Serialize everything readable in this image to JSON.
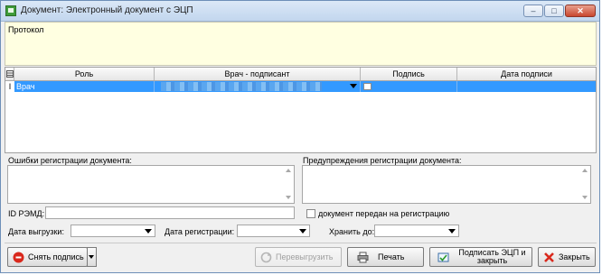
{
  "window": {
    "title": "Документ: Электронный документ с ЭЦП",
    "minimize_glyph": "–",
    "maximize_glyph": "□",
    "close_glyph": "✕"
  },
  "protocol": {
    "label": "Протокол"
  },
  "grid": {
    "columns": [
      "Роль",
      "Врач - подписант",
      "Подпись",
      "Дата подписи"
    ],
    "row_marker": "I",
    "row": {
      "role": "Врач",
      "doctor": "",
      "signature": "",
      "date": ""
    }
  },
  "errors": {
    "label": "Ошибки регистрации документа:"
  },
  "warnings": {
    "label": "Предупреждения регистрации документа:"
  },
  "form": {
    "remd_label": "ID РЭМД:",
    "remd_value": "",
    "sent_checkbox_label": "документ передан на регистрацию",
    "upload_date_label": "Дата выгрузки:",
    "reg_date_label": "Дата регистрации:",
    "store_until_label": "Хранить до:"
  },
  "buttons": {
    "remove_sign": "Снять подпись",
    "reupload": "Перевыгрузить",
    "print": "Печать",
    "sign_close": "Подписать ЭЦП и закрыть",
    "close": "Закрыть"
  },
  "colors": {
    "selection": "#3399ff",
    "protocol_bg": "#ffffe1",
    "close_red": "#d9281c"
  }
}
